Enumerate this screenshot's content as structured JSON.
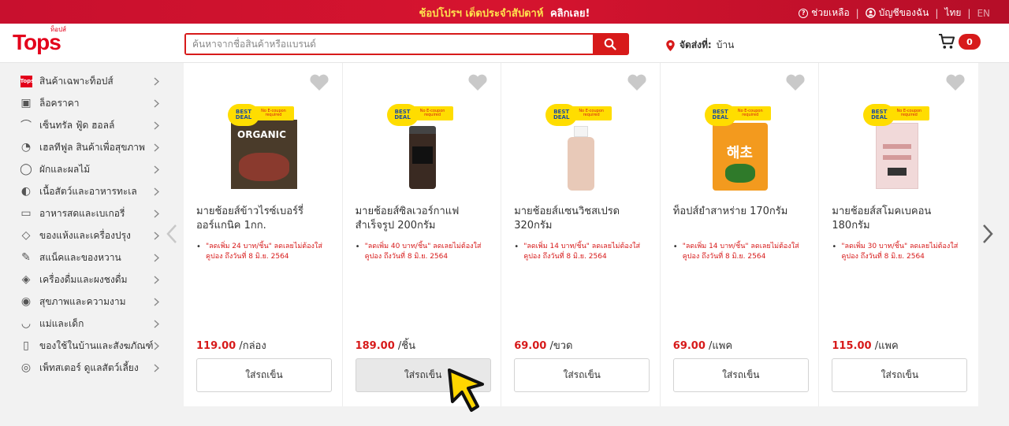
{
  "promo_bar": {
    "text": "ช้อปโปรฯ เด็ดประจำสัปดาห์",
    "cta": "คลิกเลย!"
  },
  "util": {
    "help": "ช่วยเหลือ",
    "account": "บัญชีของฉัน",
    "lang_th": "ไทย",
    "lang_en": "EN"
  },
  "header": {
    "logo": "Tops",
    "logo_small": "ท็อปส์",
    "search_placeholder": "ค้นหาจากชื่อสินค้าหรือแบรนด์",
    "delivery_label": "จัดส่งที่:",
    "delivery_value": "บ้าน",
    "cart_count": "0"
  },
  "sidebar": {
    "items": [
      {
        "label": "สินค้าเฉพาะท็อปส์",
        "icon": "tops-logo-icon"
      },
      {
        "label": "ล็อคราคา",
        "icon": "price-lock-icon"
      },
      {
        "label": "เซ็นทรัล ฟู้ด ฮอลล์",
        "icon": "food-hall-icon"
      },
      {
        "label": "เฮลทีฟูล สินค้าเพื่อสุขภาพ",
        "icon": "healthy-icon"
      },
      {
        "label": "ผักและผลไม้",
        "icon": "fruit-icon"
      },
      {
        "label": "เนื้อสัตว์และอาหารทะเล",
        "icon": "fish-icon"
      },
      {
        "label": "อาหารสดและเบเกอรี่",
        "icon": "bakery-icon"
      },
      {
        "label": "ของแห้งและเครื่องปรุง",
        "icon": "condiment-icon"
      },
      {
        "label": "สแน็คและของหวาน",
        "icon": "candy-icon"
      },
      {
        "label": "เครื่องดื่มและผงชงดื่ม",
        "icon": "drink-icon"
      },
      {
        "label": "สุขภาพและความงาม",
        "icon": "beauty-icon"
      },
      {
        "label": "แม่และเด็ก",
        "icon": "baby-icon"
      },
      {
        "label": "ของใช้ในบ้านและสังฆภัณฑ์",
        "icon": "household-icon"
      },
      {
        "label": "เพ็ทสเตอร์ ดูแลสัตว์เลี้ยง",
        "icon": "pet-icon"
      }
    ]
  },
  "badges": {
    "best_deal_1": "BEST",
    "best_deal_2": "DEAL",
    "coupon": "No E-coupon required"
  },
  "products": [
    {
      "name": "มายช้อยส์ข้าวไรซ์เบอร์รี่ออร์แกนิค 1กก.",
      "promo": "\"ลดเพิ่ม 24 บาท/ชิ้น\" ลดเลยไม่ต้องใส่คูปอง ถึงวันที่ 8 มิ.ย. 2564",
      "price": "119.00",
      "unit": "/กล่อง",
      "add_label": "ใส่รถเข็น",
      "pack_text": "ORGANIC",
      "pack_color": "#4a3b2a"
    },
    {
      "name": "มายช้อยส์ซิลเวอร์กาแฟสำเร็จรูป 200กรัม",
      "promo": "\"ลดเพิ่ม 40 บาท/ชิ้น\" ลดเลยไม่ต้องใส่คูปอง ถึงวันที่ 8 มิ.ย. 2564",
      "price": "189.00",
      "unit": "/ชิ้น",
      "add_label": "ใส่รถเข็น",
      "pack_text": "",
      "pack_color": "#3a2a22"
    },
    {
      "name": "มายช้อยส์แซนวิชสเปรด 320กรัม",
      "promo": "\"ลดเพิ่ม 14 บาท/ชิ้น\" ลดเลยไม่ต้องใส่คูปอง ถึงวันที่ 8 มิ.ย. 2564",
      "price": "69.00",
      "unit": "/ขวด",
      "add_label": "ใส่รถเข็น",
      "pack_text": "",
      "pack_color": "#e8c9b8"
    },
    {
      "name": "ท็อปส์ยำสาหร่าย 170กรัม",
      "promo": "\"ลดเพิ่ม 14 บาท/ชิ้น\" ลดเลยไม่ต้องใส่คูปอง ถึงวันที่ 8 มิ.ย. 2564",
      "price": "69.00",
      "unit": "/แพค",
      "add_label": "ใส่รถเข็น",
      "pack_text": "해초",
      "pack_color": "#f39a1e"
    },
    {
      "name": "มายช้อยส์สโมคเบคอน 180กรัม",
      "promo": "\"ลดเพิ่ม 30 บาท/ชิ้น\" ลดเลยไม่ต้องใส่คูปอง ถึงวันที่ 8 มิ.ย. 2564",
      "price": "115.00",
      "unit": "/แพค",
      "add_label": "ใส่รถเข็น",
      "pack_text": "",
      "pack_color": "#f1d9d9"
    }
  ],
  "colors": {
    "brand": "#d71a1a",
    "promo_text": "#ffe34d",
    "cursor": "#ffd600"
  }
}
